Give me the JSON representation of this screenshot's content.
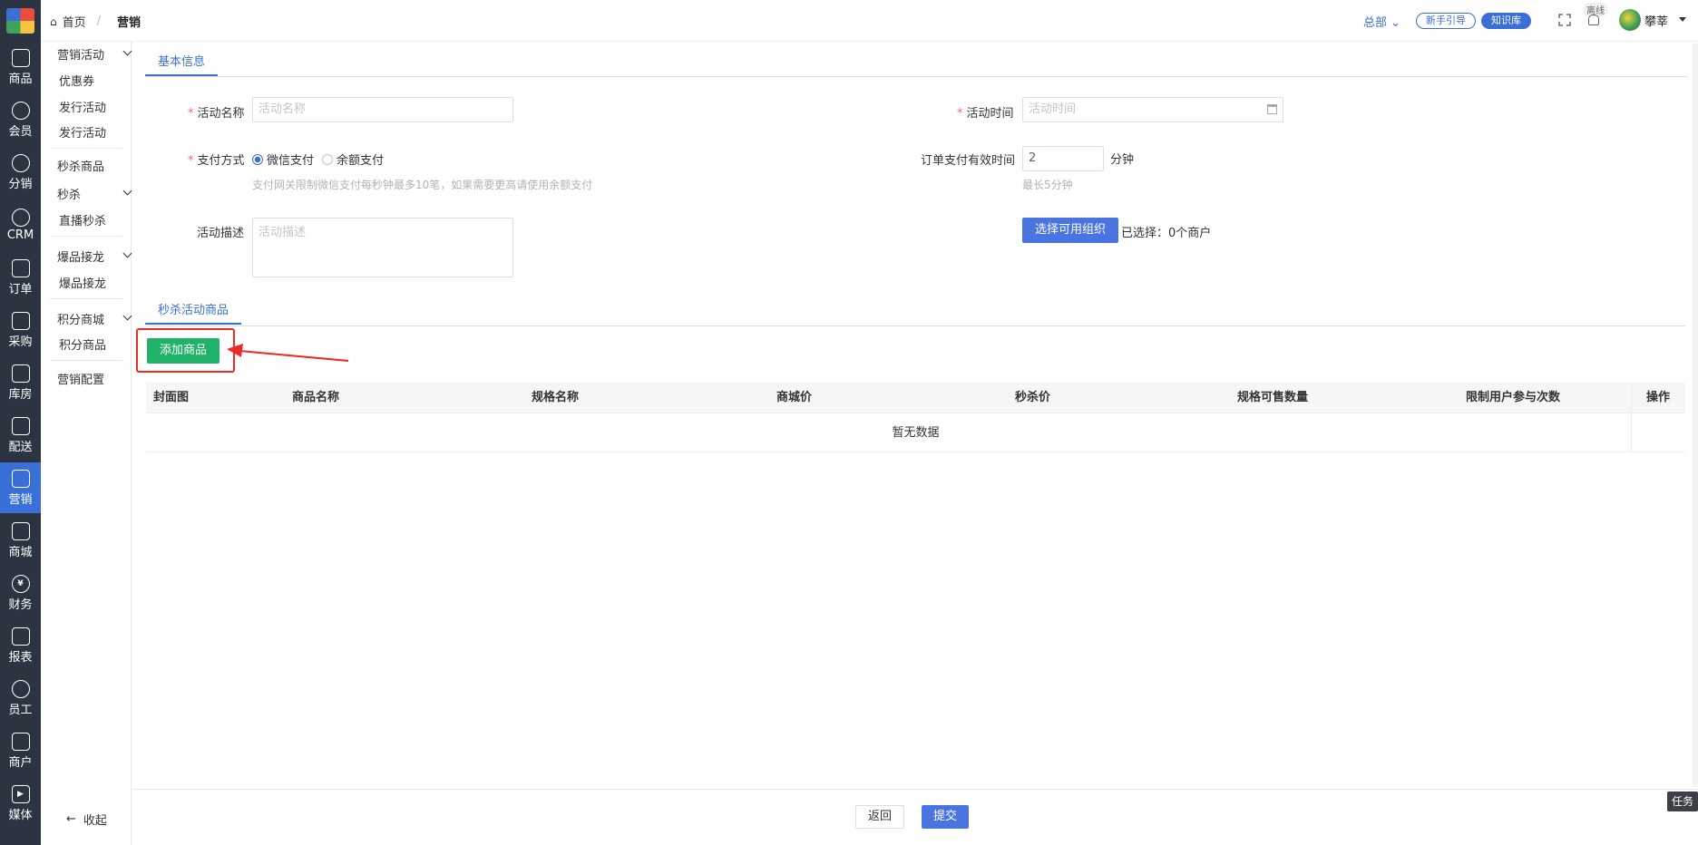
{
  "breadcrumb": {
    "home": "首页",
    "current": "营销"
  },
  "topbar": {
    "org": "总部",
    "guide": "新手引导",
    "kb": "知识库",
    "status": "离线",
    "user": "攀莘"
  },
  "rail": [
    {
      "label": "商品",
      "icon": "bag-icon"
    },
    {
      "label": "会员",
      "icon": "user-icon"
    },
    {
      "label": "分销",
      "icon": "network-icon"
    },
    {
      "label": "CRM",
      "icon": "crm-icon"
    },
    {
      "label": "订单",
      "icon": "order-icon"
    },
    {
      "label": "采购",
      "icon": "clipboard-icon"
    },
    {
      "label": "库房",
      "icon": "boxes-icon"
    },
    {
      "label": "配送",
      "icon": "truck-icon"
    },
    {
      "label": "营销",
      "icon": "gift-icon"
    },
    {
      "label": "商城",
      "icon": "house-icon"
    },
    {
      "label": "财务",
      "icon": "yen-icon"
    },
    {
      "label": "报表",
      "icon": "chart-icon"
    },
    {
      "label": "员工",
      "icon": "staff-icon"
    },
    {
      "label": "商户",
      "icon": "shop-icon"
    },
    {
      "label": "媒体",
      "icon": "play-icon"
    }
  ],
  "submenu": {
    "g1": "营销活动",
    "g1_items": [
      "优惠券",
      "发行活动",
      "发行活动"
    ],
    "seckill_goods": "秒杀商品",
    "g2": "秒杀",
    "g2_items": [
      "直播秒杀"
    ],
    "g3": "爆品接龙",
    "g3_items": [
      "爆品接龙"
    ],
    "g4": "积分商城",
    "g4_items": [
      "积分商品"
    ],
    "config": "营销配置",
    "collapse": "收起"
  },
  "form": {
    "tab_basic": "基本信息",
    "name_label": "活动名称",
    "name_placeholder": "活动名称",
    "time_label": "活动时间",
    "time_placeholder": "活动时间",
    "pay_label": "支付方式",
    "pay_wechat": "微信支付",
    "pay_balance": "余额支付",
    "pay_hint": "支付网关限制微信支付每秒钟最多10笔，如果需要更高请使用余额支付",
    "order_valid_label": "订单支付有效时间",
    "order_valid_value": "2",
    "order_valid_unit": "分钟",
    "order_valid_hint": "最长5分钟",
    "desc_label": "活动描述",
    "desc_placeholder": "活动描述",
    "select_org_btn": "选择可用组织",
    "selected_text": "已选择：0个商户"
  },
  "goods": {
    "tab": "秒杀活动商品",
    "add_btn": "添加商品",
    "columns": [
      "封面图",
      "商品名称",
      "规格名称",
      "商城价",
      "秒杀价",
      "规格可售数量",
      "限制用户参与次数",
      "操作"
    ],
    "empty": "暂无数据"
  },
  "footer": {
    "back": "返回",
    "submit": "提交"
  },
  "task": "任务",
  "colors": {
    "accent": "#3a6fd8",
    "green": "#21b26a",
    "highlight": "#ee2a24",
    "rail": "#2d3441"
  }
}
